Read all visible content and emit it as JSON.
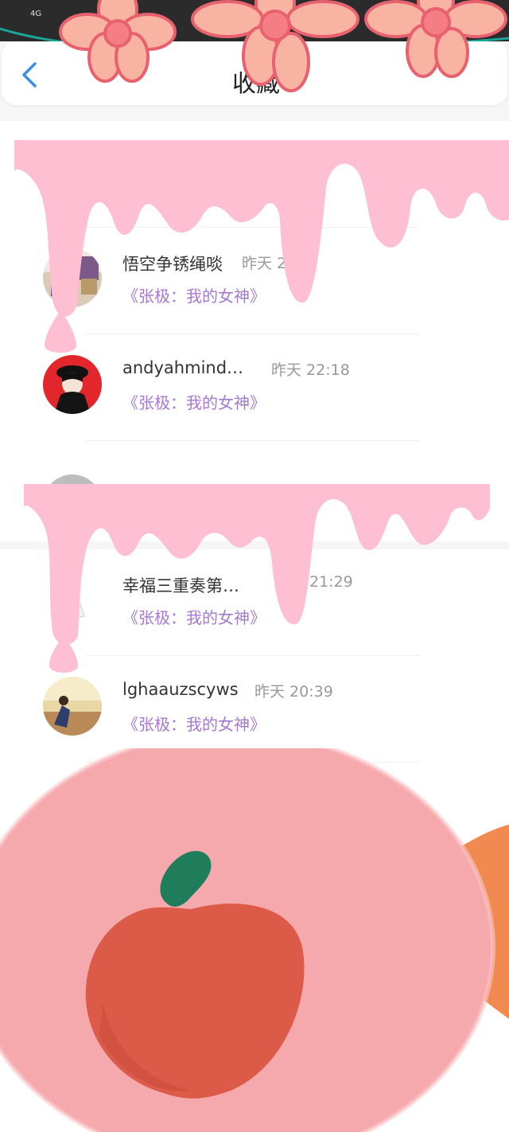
{
  "status_bar": {
    "left": "4G",
    "right": ""
  },
  "header": {
    "title": "收藏"
  },
  "items": [
    {
      "name": "悟空争锈绳啖",
      "time": "昨天 2",
      "work": "《张极：我的女神》"
    },
    {
      "name": "andyahmind…",
      "time": "昨天 22:18",
      "work": "《张极：我的女神》"
    },
    {
      "name": "幸福三重奏第…",
      "time": "21:29",
      "work": "《张极：我的女神》"
    },
    {
      "name": "lghaauzscyws",
      "time": "昨天 20:39",
      "work": "《张极：我的女神》"
    }
  ],
  "colors": {
    "accent": "#a679d1",
    "back": "#3a8ee6",
    "drip": "#ffbfd3",
    "flower": "#f7b0a4",
    "ball": "#f6a9ad",
    "apple": "#dc5a48"
  },
  "icons": [
    "back-chevron-icon",
    "flower-sticker",
    "drip-sticker",
    "apple-sticker"
  ]
}
